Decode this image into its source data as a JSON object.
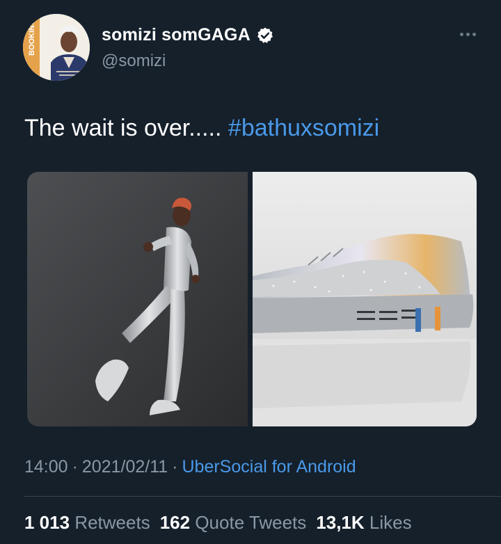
{
  "profile": {
    "display_name": "somizi somGAGA",
    "handle": "@somizi",
    "verified_icon": "verified-badge-icon",
    "avatar_text": "BOOKING"
  },
  "more_icon": "more-options-icon",
  "tweet": {
    "text_plain": "The wait is over.....",
    "hashtag": "#bathuxsomizi"
  },
  "meta": {
    "time": "14:00",
    "separator": "·",
    "date": "2021/02/11",
    "source": "UberSocial for Android"
  },
  "stats": {
    "retweets_count": "1 013",
    "retweets_label": "Retweets",
    "quotes_count": "162",
    "quotes_label": "Quote Tweets",
    "likes_count": "13,1K",
    "likes_label": "Likes"
  },
  "colors": {
    "background": "#15202b",
    "accent": "#4a99e9",
    "muted": "#8b98a5",
    "divider": "#38444d"
  }
}
